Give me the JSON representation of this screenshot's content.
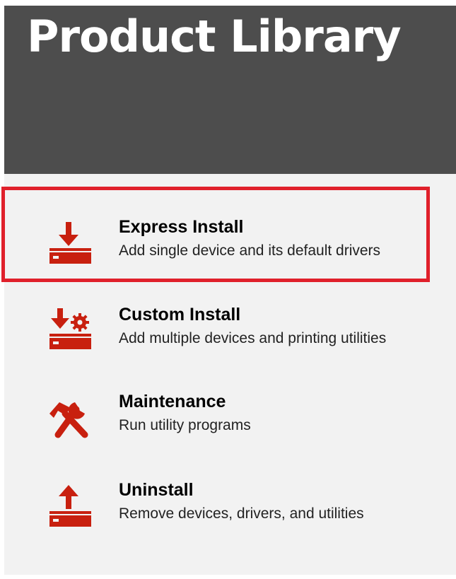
{
  "app": {
    "title": "Product Library"
  },
  "colors": {
    "header_bg": "#4d4d4d",
    "body_bg": "#f2f2f2",
    "icon_red": "#c8200f",
    "highlight_border": "#e0202b"
  },
  "menu": {
    "items": [
      {
        "id": "express-install",
        "icon": "download-icon",
        "label": "Express Install",
        "description": "Add single device and its default drivers",
        "highlighted": true
      },
      {
        "id": "custom-install",
        "icon": "download-gear-icon",
        "label": "Custom Install",
        "description": "Add multiple devices and printing utilities",
        "highlighted": false
      },
      {
        "id": "maintenance",
        "icon": "hammer-wrench-icon",
        "label": "Maintenance",
        "description": "Run utility programs",
        "highlighted": false
      },
      {
        "id": "uninstall",
        "icon": "upload-icon",
        "label": "Uninstall",
        "description": "Remove devices, drivers, and utilities",
        "highlighted": false
      }
    ]
  }
}
